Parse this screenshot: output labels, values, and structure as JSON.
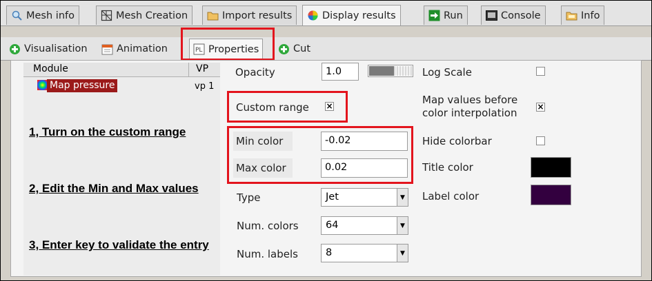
{
  "main_tabs": [
    {
      "label": "Mesh info",
      "icon": "magnifier-icon"
    },
    {
      "label": "Mesh Creation",
      "icon": "grid-icon"
    },
    {
      "label": "Import results",
      "icon": "folder-icon"
    },
    {
      "label": "Display results",
      "icon": "color-wheel-icon"
    },
    {
      "label": "Run",
      "icon": "arrow-right-icon"
    },
    {
      "label": "Console",
      "icon": "terminal-icon"
    },
    {
      "label": "Info",
      "icon": "info-folder-icon"
    }
  ],
  "sub_tabs": [
    {
      "label": "Visualisation",
      "icon": "plus-green-icon"
    },
    {
      "label": "Animation",
      "icon": "calendar-icon"
    },
    {
      "label": "Properties",
      "icon": "properties-icon"
    },
    {
      "label": "Cut",
      "icon": "plus-green-icon"
    }
  ],
  "module_list": {
    "header_module": "Module",
    "header_vp": "VP",
    "items": [
      {
        "name": "Map pressure",
        "vp": "vp 1"
      }
    ]
  },
  "instructions": [
    "1, Turn on the custom range",
    "2, Edit the Min and Max values",
    "3, Enter key to validate the entry"
  ],
  "properties": {
    "opacity_label": "Opacity",
    "opacity_value": "1.0",
    "opacity_slider_fraction": 1.0,
    "custom_range_label": "Custom range",
    "custom_range_checked": "×",
    "min_color_label": "Min color",
    "min_color_value": "-0.02",
    "max_color_label": "Max color",
    "max_color_value": "0.02",
    "type_label": "Type",
    "type_value": "Jet",
    "num_colors_label": "Num. colors",
    "num_colors_value": "64",
    "num_labels_label": "Num. labels",
    "num_labels_value": "8",
    "log_scale_label": "Log Scale",
    "map_values_label_line1": "Map values before",
    "map_values_label_line2": "color interpolation",
    "map_values_checked": "×",
    "hide_colorbar_label": "Hide colorbar",
    "title_color_label": "Title color",
    "label_color_label": "Label color"
  },
  "colors": {
    "title_color": "#000000",
    "label_color": "#33003f",
    "highlight": "#e3141d",
    "selected_item": "#9b1a1a"
  }
}
